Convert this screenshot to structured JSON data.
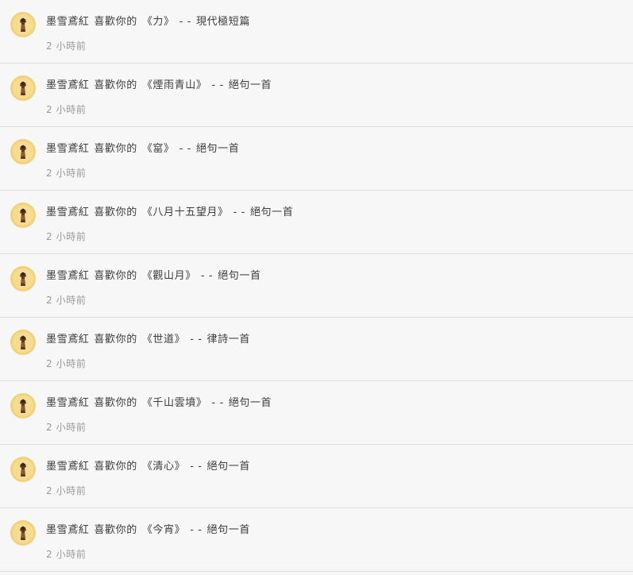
{
  "notifications": [
    {
      "user": "墨雪鳶紅",
      "action": "喜歡你的",
      "title": "《力》",
      "separator": "- -",
      "category": "現代極短篇",
      "time": "2 小時前"
    },
    {
      "user": "墨雪鳶紅",
      "action": "喜歡你的",
      "title": "《煙雨青山》",
      "separator": "- -",
      "category": "絕句一首",
      "time": "2 小時前"
    },
    {
      "user": "墨雪鳶紅",
      "action": "喜歡你的",
      "title": "《窰》",
      "separator": "- -",
      "category": "絕句一首",
      "time": "2 小時前"
    },
    {
      "user": "墨雪鳶紅",
      "action": "喜歡你的",
      "title": "《八月十五望月》",
      "separator": "- -",
      "category": "絕句一首",
      "time": "2 小時前"
    },
    {
      "user": "墨雪鳶紅",
      "action": "喜歡你的",
      "title": "《觀山月》",
      "separator": "- -",
      "category": "絕句一首",
      "time": "2 小時前"
    },
    {
      "user": "墨雪鳶紅",
      "action": "喜歡你的",
      "title": "《世道》",
      "separator": "- -",
      "category": "律詩一首",
      "time": "2 小時前"
    },
    {
      "user": "墨雪鳶紅",
      "action": "喜歡你的",
      "title": "《千山雲墳》",
      "separator": "- -",
      "category": "絕句一首",
      "time": "2 小時前"
    },
    {
      "user": "墨雪鳶紅",
      "action": "喜歡你的",
      "title": "《清心》",
      "separator": "- -",
      "category": "絕句一首",
      "time": "2 小時前"
    },
    {
      "user": "墨雪鳶紅",
      "action": "喜歡你的",
      "title": "《今宵》",
      "separator": "- -",
      "category": "絕句一首",
      "time": "2 小時前"
    }
  ]
}
